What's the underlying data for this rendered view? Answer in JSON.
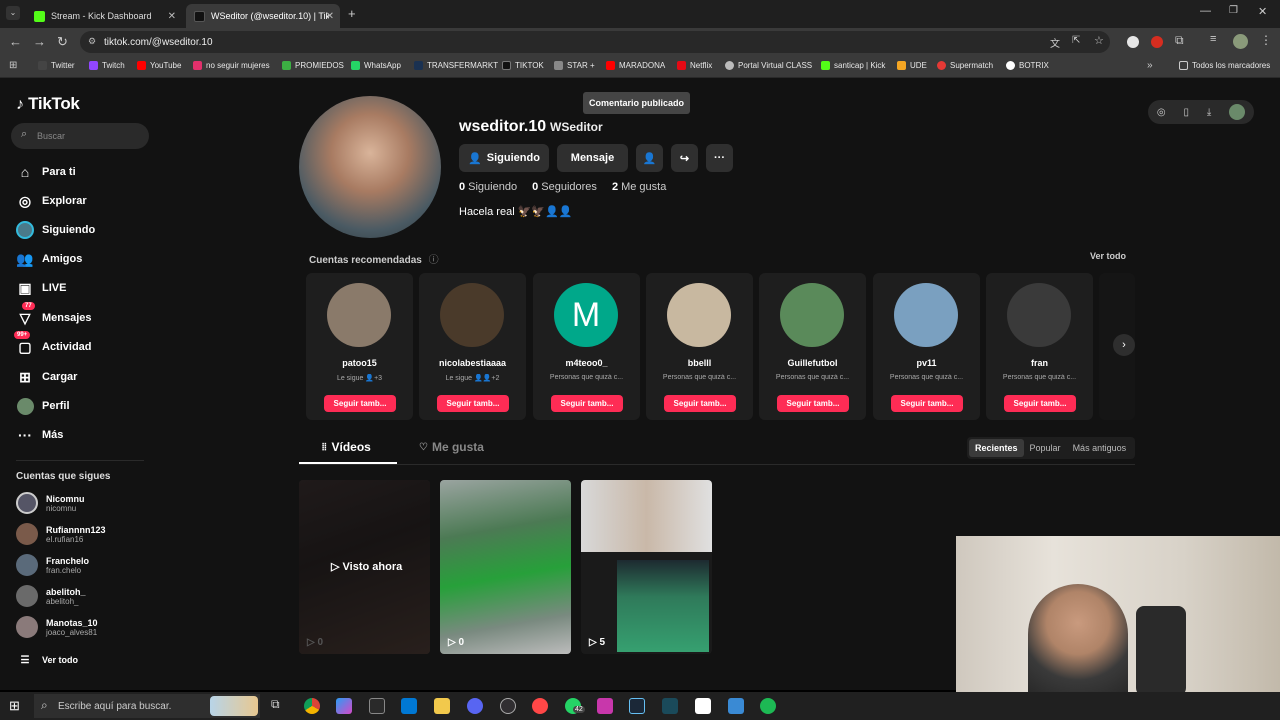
{
  "browser": {
    "tabs": [
      {
        "title": "Stream - Kick Dashboard",
        "color": "#53fc18"
      },
      {
        "title": "WSeditor (@wseditor.10) | TikTok",
        "color": "#111111"
      }
    ],
    "url": "tiktok.com/@wseditor.10",
    "bookmarks": [
      {
        "label": "Twitter",
        "color": "#444"
      },
      {
        "label": "Twitch",
        "color": "#9146ff"
      },
      {
        "label": "YouTube",
        "color": "#ff0000"
      },
      {
        "label": "no seguir mujeres",
        "color": "#e1306c"
      },
      {
        "label": "PROMIEDOS",
        "color": "#3cb043"
      },
      {
        "label": "WhatsApp",
        "color": "#25d366"
      },
      {
        "label": "TRANSFERMARKT",
        "color": "#1a3151"
      },
      {
        "label": "TIKTOK",
        "color": "#111"
      },
      {
        "label": "STAR +",
        "color": "#888"
      },
      {
        "label": "MARADONA",
        "color": "#ff0000"
      },
      {
        "label": "Netflix",
        "color": "#e50914"
      },
      {
        "label": "Portal Virtual CLASS",
        "color": "#bbb"
      },
      {
        "label": "santicap | Kick",
        "color": "#53fc18"
      },
      {
        "label": "UDE",
        "color": "#f5a623"
      },
      {
        "label": "Supermatch",
        "color": "#e53935"
      },
      {
        "label": "BOTRIX",
        "color": "#ffffff"
      }
    ],
    "all_bookmarks": "Todos los marcadores"
  },
  "sidebar": {
    "logo": "TikTok",
    "search_placeholder": "Buscar",
    "nav": [
      {
        "label": "Para ti",
        "icon": "home-icon"
      },
      {
        "label": "Explorar",
        "icon": "compass-icon"
      },
      {
        "label": "Siguiendo",
        "icon": "following-avatar-icon"
      },
      {
        "label": "Amigos",
        "icon": "friends-icon"
      },
      {
        "label": "LIVE",
        "icon": "live-icon"
      },
      {
        "label": "Mensajes",
        "icon": "messages-icon",
        "badge": "77"
      },
      {
        "label": "Actividad",
        "icon": "activity-icon",
        "badge": "99+"
      },
      {
        "label": "Cargar",
        "icon": "upload-icon"
      },
      {
        "label": "Perfil",
        "icon": "profile-avatar-icon"
      },
      {
        "label": "Más",
        "icon": "more-icon"
      }
    ],
    "following_title": "Cuentas que sigues",
    "following": [
      {
        "name": "Nicomnu",
        "handle": "nicomnu"
      },
      {
        "name": "Rufiannnn123",
        "handle": "el.rufian16"
      },
      {
        "name": "Franchelo",
        "handle": "fran.chelo"
      },
      {
        "name": "abelitoh_",
        "handle": "abelitoh_"
      },
      {
        "name": "Manotas_10",
        "handle": "joaco_alves81"
      }
    ],
    "see_all": "Ver todo"
  },
  "profile": {
    "username": "wseditor.10",
    "nickname": "WSeditor",
    "following_button": "Siguiendo",
    "message_button": "Mensaje",
    "following_count": "0",
    "following_label": "Siguiendo",
    "followers_count": "0",
    "followers_label": "Seguidores",
    "likes_count": "2",
    "likes_label": "Me gusta",
    "bio": "Hacela real 🦅🦅👤👤",
    "tooltip": "Comentario publicado"
  },
  "recommended": {
    "title": "Cuentas recomendadas",
    "see_all": "Ver todo",
    "follow_label": "Seguir tamb...",
    "accounts": [
      {
        "name": "patoo15",
        "sub": "Le sigue 👤+3",
        "color": "#8a7a6a"
      },
      {
        "name": "nicolabestiaaaa",
        "sub": "Le sigue 👤👤+2",
        "color": "#4a3a2a"
      },
      {
        "name": "m4teoo0_",
        "sub": "Personas que quizá c...",
        "color": "#00a88a",
        "initial": "M"
      },
      {
        "name": "bbelll",
        "sub": "Personas que quizá c...",
        "color": "#c8b8a0"
      },
      {
        "name": "Guillefutbol",
        "sub": "Personas que quizá c...",
        "color": "#5a8a5a"
      },
      {
        "name": "pv11",
        "sub": "Personas que quizá c...",
        "color": "#7aa0c0"
      },
      {
        "name": "fran",
        "sub": "Personas que quizá c...",
        "color": "#3a3a3a"
      }
    ]
  },
  "tabs": {
    "videos": "Vídeos",
    "likes": "Me gusta"
  },
  "sort": {
    "recent": "Recientes",
    "popular": "Popular",
    "oldest": "Más antiguos"
  },
  "videos": [
    {
      "overlay": "Visto ahora",
      "plays": "0"
    },
    {
      "plays": "0"
    },
    {
      "plays": "5"
    }
  ],
  "taskbar": {
    "search_placeholder": "Escribe aquí para buscar.",
    "whatsapp_badge": "42"
  }
}
